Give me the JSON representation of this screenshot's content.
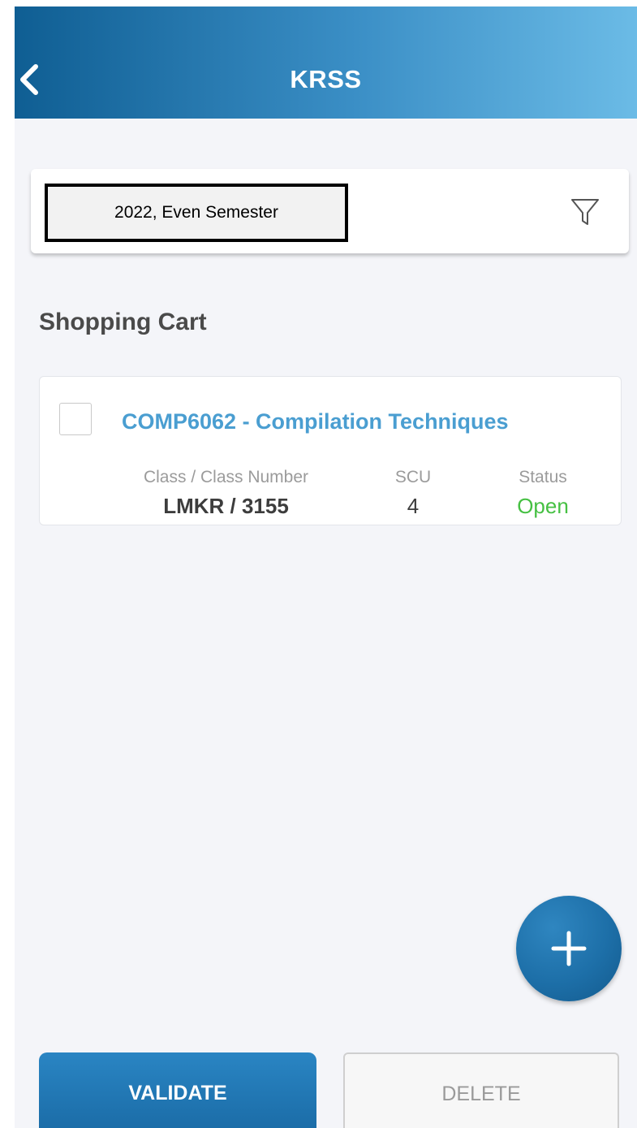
{
  "header": {
    "title": "KRSS",
    "back_icon": "chevron-left-icon"
  },
  "filter": {
    "semester": "2022, Even Semester",
    "filter_icon": "funnel-icon"
  },
  "cart": {
    "section_title": "Shopping Cart",
    "items": [
      {
        "course": "COMP6062 - Compilation Techniques",
        "checked": false,
        "class_label": "Class / Class Number",
        "class_value": "LMKR / 3155",
        "scu_label": "SCU",
        "scu_value": "4",
        "status_label": "Status",
        "status_value": "Open",
        "status_color": "#46c043"
      }
    ]
  },
  "fab": {
    "icon": "plus-icon"
  },
  "actions": {
    "validate_label": "VALIDATE",
    "delete_label": "DELETE"
  },
  "colors": {
    "header_gradient_start": "#0f5e93",
    "header_gradient_end": "#6bbbe6",
    "accent": "#1d6fa8",
    "course_title": "#4a9ed1",
    "status_open": "#46c043"
  }
}
